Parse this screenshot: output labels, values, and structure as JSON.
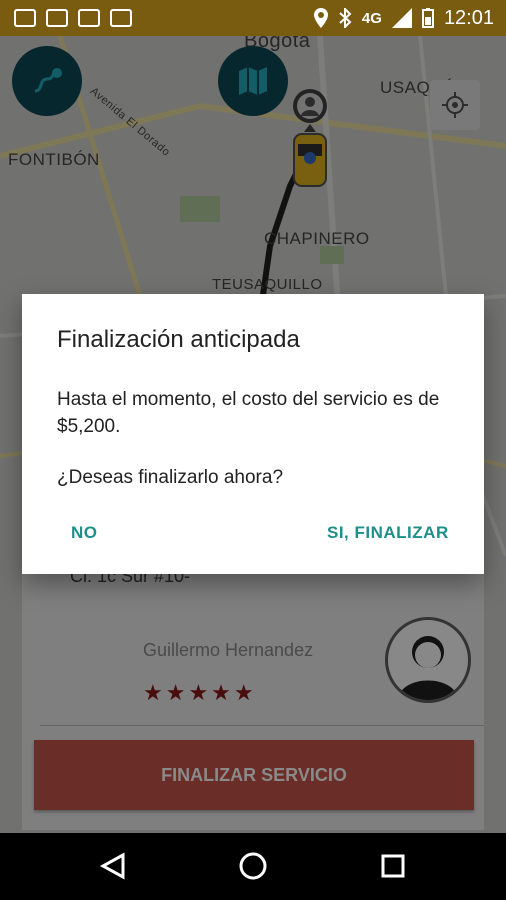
{
  "status_bar": {
    "network": "4G",
    "time": "12:01"
  },
  "map": {
    "labels": {
      "city": "Bogotá",
      "fontibon": "FONTIBÓN",
      "usaquen": "USAQUÉ",
      "chapinero": "CHAPINERO",
      "teusaquillo": "TEUSAQUILLO",
      "avenue": "Avenida El Dorado"
    }
  },
  "dialog": {
    "title": "Finalización anticipada",
    "message": "Hasta el momento, el costo del servicio es de $5,200.",
    "question": "¿Deseas finalizarlo ahora?",
    "no_label": "NO",
    "yes_label": "SI, FINALIZAR"
  },
  "trip": {
    "address": "Cl. 1c Sur #10-"
  },
  "driver": {
    "name": "Guillermo Hernandez",
    "rating_stars": "★★★★★",
    "rating": 5
  },
  "actions": {
    "finish_label": "FINALIZAR SERVICIO"
  },
  "colors": {
    "status_bar": "#7a5c10",
    "fab": "#0f4c5a",
    "accent": "#1f8f8a",
    "finish_button": "#d65a4f",
    "stars": "#8a1a1a"
  }
}
